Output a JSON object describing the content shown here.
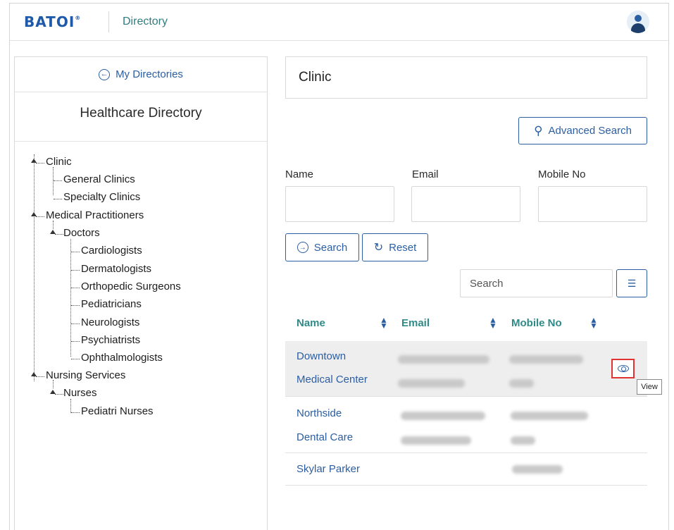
{
  "header": {
    "logo_text": "BATOI",
    "logo_mark": "®",
    "app_title": "Directory",
    "avatar_icon": "user-avatar-icon"
  },
  "sidebar": {
    "back_label": "My Directories",
    "title": "Healthcare Directory",
    "tree": [
      {
        "label": "Clinic",
        "level": 0
      },
      {
        "label": "General Clinics",
        "level": 1
      },
      {
        "label": "Specialty Clinics",
        "level": 1
      },
      {
        "label": "Medical Practitioners",
        "level": 0
      },
      {
        "label": "Doctors",
        "level": 1
      },
      {
        "label": "Cardiologists",
        "level": 2
      },
      {
        "label": "Dermatologists",
        "level": 2
      },
      {
        "label": "Orthopedic Surgeons",
        "level": 2
      },
      {
        "label": "Pediatricians",
        "level": 2
      },
      {
        "label": "Neurologists",
        "level": 2
      },
      {
        "label": "Psychiatrists",
        "level": 2
      },
      {
        "label": "Ophthalmologists",
        "level": 2
      },
      {
        "label": "Nursing Services",
        "level": 0
      },
      {
        "label": "Nurses",
        "level": 1
      },
      {
        "label": "Pediatri Nurses",
        "level": 2
      }
    ]
  },
  "main": {
    "section_title": "Clinic",
    "advanced_search_label": "Advanced Search",
    "filters": {
      "name_label": "Name",
      "email_label": "Email",
      "mobile_label": "Mobile No"
    },
    "search_label": "Search",
    "reset_label": "Reset",
    "table_search_placeholder": "Search",
    "table": {
      "columns": [
        "Name",
        "Email",
        "Mobile No"
      ],
      "rows": [
        {
          "name_line1": "Downtown",
          "name_line2": "Medical Center"
        },
        {
          "name_line1": "Northside",
          "name_line2": "Dental Care"
        },
        {
          "name_line1": "Skylar Parker",
          "name_line2": ""
        }
      ]
    },
    "view_tooltip": "View"
  },
  "colors": {
    "brand_blue": "#2b5ea3",
    "teal": "#2f8a88",
    "highlight_red": "#e03434"
  }
}
